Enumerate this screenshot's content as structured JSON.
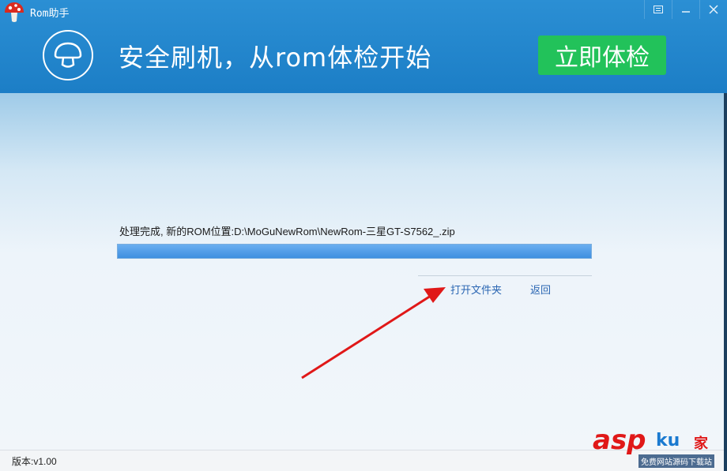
{
  "window": {
    "title": "Rom助手",
    "controls": [
      "menu-icon",
      "minimize-icon",
      "close-icon"
    ]
  },
  "header": {
    "slogan": "安全刷机，从rom体检开始",
    "check_button": "立即体检",
    "brand_icon": "mushroom-icon"
  },
  "main": {
    "status_text": "处理完成, 新的ROM位置:D:\\MoGuNewRom\\NewRom-三星GT-S7562_.zip",
    "progress": 1.0,
    "open_folder_link": "打开文件夹",
    "back_link": "返回"
  },
  "footer": {
    "version": "版本:v1.00"
  },
  "watermark": {
    "asp": "asp",
    "ku": "ku",
    "jia": "家",
    "sub": "免费网站源码下载站"
  },
  "colors": {
    "header_blue": "#1c7ec6",
    "button_green": "#22c25a",
    "link_blue": "#2b66b3",
    "progress_blue": "#4a98e6",
    "annotation_red": "#e01818"
  }
}
